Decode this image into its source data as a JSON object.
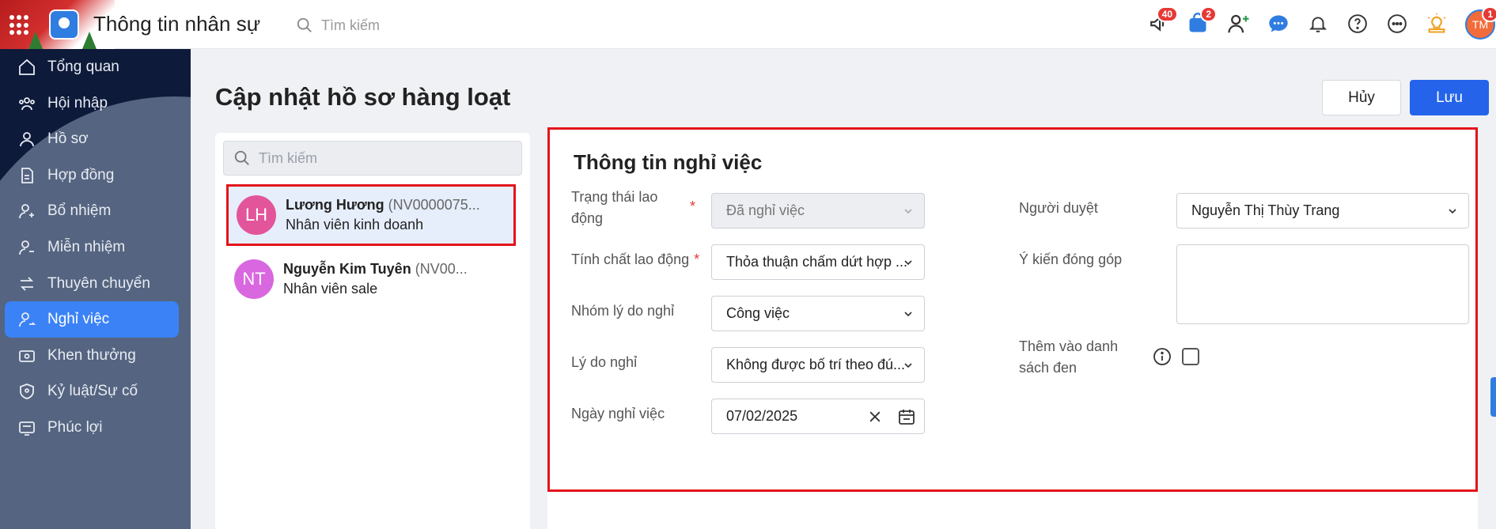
{
  "header": {
    "app_title": "Thông tin nhân sự",
    "search_placeholder": "Tìm kiếm",
    "badges": {
      "announcements": "40",
      "cart": "2",
      "avatar": "1"
    },
    "avatar_initials": "TM"
  },
  "sidebar": {
    "items": [
      {
        "label": "Tổng quan",
        "icon": "home-icon"
      },
      {
        "label": "Hội nhập",
        "icon": "users-icon"
      },
      {
        "label": "Hồ sơ",
        "icon": "user-icon"
      },
      {
        "label": "Hợp đồng",
        "icon": "document-icon"
      },
      {
        "label": "Bổ nhiệm",
        "icon": "user-plus-icon"
      },
      {
        "label": "Miễn nhiệm",
        "icon": "user-minus-icon"
      },
      {
        "label": "Thuyên chuyển",
        "icon": "transfer-icon"
      },
      {
        "label": "Nghỉ việc",
        "icon": "user-leave-icon"
      },
      {
        "label": "Khen thưởng",
        "icon": "reward-icon"
      },
      {
        "label": "Kỷ luật/Sự cố",
        "icon": "shield-icon"
      },
      {
        "label": "Phúc lợi",
        "icon": "benefit-icon"
      }
    ],
    "active_index": 7
  },
  "page": {
    "title": "Cập nhật hồ sơ hàng loạt",
    "cancel_label": "Hủy",
    "save_label": "Lưu"
  },
  "employee_list": {
    "search_placeholder": "Tìm kiếm",
    "employees": [
      {
        "initials": "LH",
        "name": "Lương Hương",
        "code": "(NV0000075...",
        "role": "Nhân viên kinh doanh",
        "avatar_color": "#e3559a"
      },
      {
        "initials": "NT",
        "name": "Nguyễn Kim Tuyên",
        "code": "(NV00...",
        "role": "Nhân viên sale",
        "avatar_color": "#d967e0"
      }
    ]
  },
  "form": {
    "section_title": "Thông tin nghỉ việc",
    "trang_thai": {
      "label": "Trạng thái lao động",
      "value": "Đã nghỉ việc",
      "required": "*"
    },
    "tinh_chat": {
      "label": "Tính chất lao động",
      "value": "Thỏa thuận chấm dứt hợp ...",
      "required": "*"
    },
    "nhom_ly_do": {
      "label": "Nhóm lý do nghỉ",
      "value": "Công việc"
    },
    "ly_do": {
      "label": "Lý do nghỉ",
      "value": "Không được bố trí theo đú..."
    },
    "ngay_nghi": {
      "label": "Ngày nghỉ việc",
      "value": "07/02/2025"
    },
    "nguoi_duyet": {
      "label": "Người duyệt",
      "value": "Nguyễn Thị Thùy Trang"
    },
    "y_kien": {
      "label": "Ý kiến đóng góp",
      "value": ""
    },
    "blacklist": {
      "label": "Thêm vào danh sách đen"
    }
  },
  "colors": {
    "primary": "#2563eb",
    "highlight_border": "#e3141b",
    "sidebar_bg": "#556480",
    "sidebar_dark": "#0e1a3a"
  }
}
